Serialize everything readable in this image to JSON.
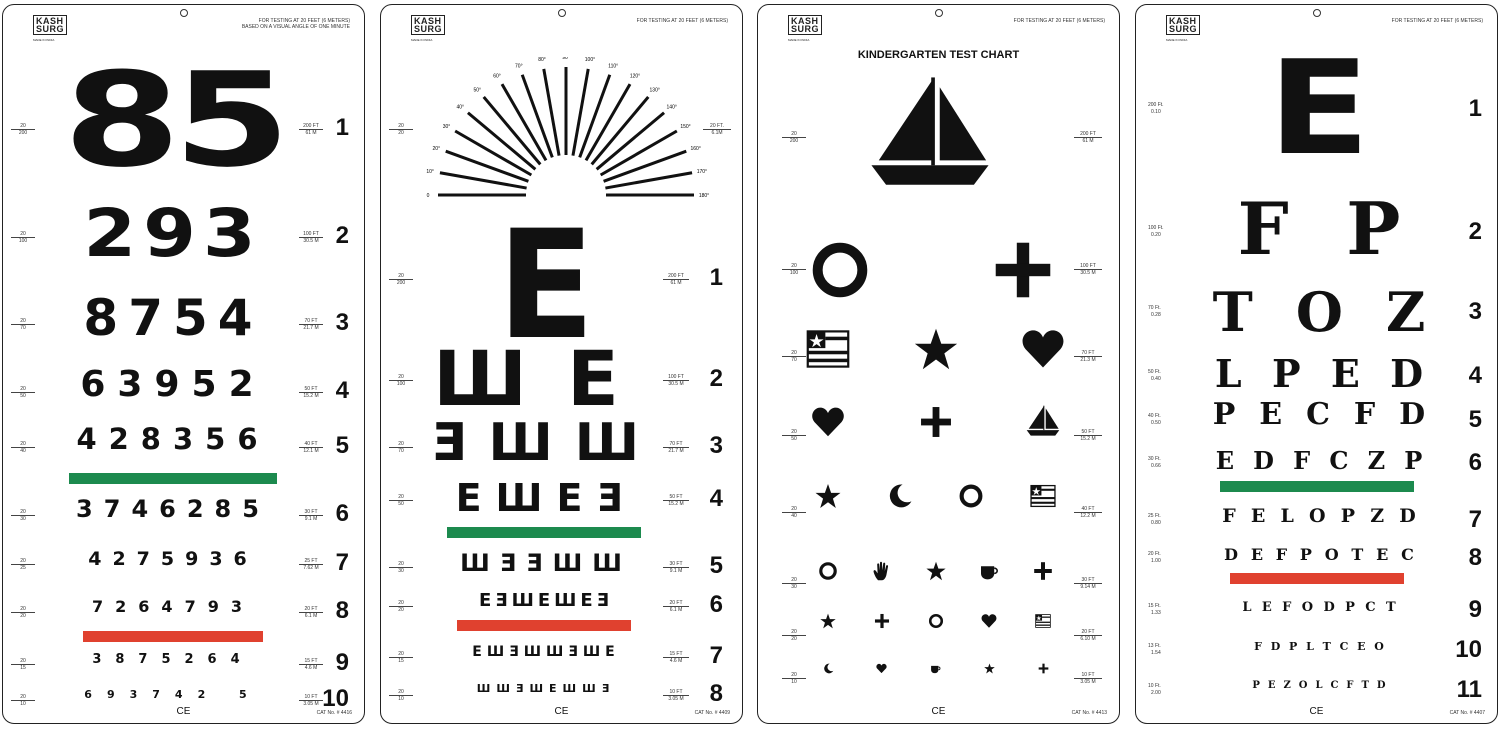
{
  "logo": {
    "line1": "KASH",
    "line2": "SURG",
    "sub": "MADE IN INDIA"
  },
  "header_line1": "FOR TESTING AT 20 FEET (6 METERS)",
  "header_line2": "BASED ON A VISUAL ANGLE OF ONE MINUTE",
  "ce_mark": "CE",
  "colors": {
    "green": "#1c8a4e",
    "red": "#e0412f"
  },
  "chart1": {
    "cat": "CAT No. # 4416",
    "rows": [
      {
        "snellen": [
          "20",
          "200"
        ],
        "text": "85",
        "feet": [
          "200 FT",
          "61 M"
        ],
        "num": "1"
      },
      {
        "snellen": [
          "20",
          "100"
        ],
        "text": "293",
        "feet": [
          "100 FT",
          "30.5 M"
        ],
        "num": "2"
      },
      {
        "snellen": [
          "20",
          "70"
        ],
        "text": "8754",
        "feet": [
          "70 FT",
          "21.7 M"
        ],
        "num": "3"
      },
      {
        "snellen": [
          "20",
          "50"
        ],
        "text": "63952",
        "feet": [
          "50 FT",
          "15.2 M"
        ],
        "num": "4"
      },
      {
        "snellen": [
          "20",
          "40"
        ],
        "text": "428356",
        "feet": [
          "40 FT",
          "12.1 M"
        ],
        "num": "5"
      },
      {
        "snellen": [
          "20",
          "30"
        ],
        "text": "3746285",
        "feet": [
          "30 FT",
          "9.1 M"
        ],
        "num": "6"
      },
      {
        "snellen": [
          "20",
          "25"
        ],
        "text": "4275936",
        "feet": [
          "25 FT",
          "7.62 M"
        ],
        "num": "7"
      },
      {
        "snellen": [
          "20",
          "20"
        ],
        "text": "7264793",
        "feet": [
          "20 FT",
          "6.1 M"
        ],
        "num": "8"
      },
      {
        "snellen": [
          "20",
          "15"
        ],
        "text": "3875264",
        "feet": [
          "15 FT",
          "4.6 M"
        ],
        "num": "9"
      },
      {
        "snellen": [
          "20",
          "10"
        ],
        "text": "693742 5",
        "feet": [
          "10 FT",
          "3.05 M"
        ],
        "num": "10"
      }
    ]
  },
  "chart2": {
    "cat": "CAT No. # 4409",
    "astig_labels": [
      "0",
      "10°",
      "20°",
      "30°",
      "40°",
      "50°",
      "60°",
      "70°",
      "80°",
      "90°",
      "100°",
      "110°",
      "120°",
      "130°",
      "140°",
      "150°",
      "160°",
      "170°",
      "180°"
    ],
    "astig_snellen": [
      "20",
      "20"
    ],
    "astig_feet": [
      "20 FT.",
      "6.1M"
    ],
    "rows": [
      {
        "snellen": [
          "20",
          "200"
        ],
        "text": "E",
        "feet": [
          "200 FT",
          "61 M"
        ],
        "num": "1"
      },
      {
        "snellen": [
          "20",
          "100"
        ],
        "text": "ШE",
        "feet": [
          "100 FT",
          "30.5 M"
        ],
        "num": "2"
      },
      {
        "snellen": [
          "20",
          "70"
        ],
        "text": "ƎШШ",
        "feet": [
          "70 FT",
          "21.7 M"
        ],
        "num": "3"
      },
      {
        "snellen": [
          "20",
          "50"
        ],
        "text": "EШEƎ",
        "feet": [
          "50 FT",
          "15.2 M"
        ],
        "num": "4"
      },
      {
        "snellen": [
          "20",
          "30"
        ],
        "text": "ШƎƎШШ",
        "feet": [
          "30 FT",
          "9.1 M"
        ],
        "num": "5"
      },
      {
        "snellen": [
          "20",
          "20"
        ],
        "text": "EƎШEШEƎ",
        "feet": [
          "20 FT",
          "6.1 M"
        ],
        "num": "6"
      },
      {
        "snellen": [
          "20",
          "15"
        ],
        "text": "EШƎШШƎШE",
        "feet": [
          "15 FT",
          "4.6 M"
        ],
        "num": "7"
      },
      {
        "snellen": [
          "20",
          "10"
        ],
        "text": "ШШƎШEШШƎ",
        "feet": [
          "10 FT",
          "3.05 M"
        ],
        "num": "8"
      }
    ]
  },
  "chart3": {
    "cat": "CAT No. # 4413",
    "title": "KINDERGARTEN TEST CHART",
    "rows": [
      {
        "snellen": [
          "20",
          "200"
        ],
        "feet": [
          "200 FT",
          "61 M"
        ],
        "icons": [
          "sailboat"
        ]
      },
      {
        "snellen": [
          "20",
          "100"
        ],
        "feet": [
          "100 FT",
          "30.5 M"
        ],
        "icons": [
          "circle",
          "plus"
        ]
      },
      {
        "snellen": [
          "20",
          "70"
        ],
        "feet": [
          "70 FT",
          "21.3 M"
        ],
        "icons": [
          "flag",
          "star",
          "heart"
        ]
      },
      {
        "snellen": [
          "20",
          "50"
        ],
        "feet": [
          "50 FT",
          "15.2 M"
        ],
        "icons": [
          "heart",
          "plus",
          "sailboat"
        ]
      },
      {
        "snellen": [
          "20",
          "40"
        ],
        "feet": [
          "40 FT",
          "12.2 M"
        ],
        "icons": [
          "star",
          "moon",
          "circle",
          "flag"
        ]
      },
      {
        "snellen": [
          "20",
          "30"
        ],
        "feet": [
          "30 FT",
          "9.14 M"
        ],
        "icons": [
          "circle",
          "hand",
          "star",
          "cup",
          "plus"
        ]
      },
      {
        "snellen": [
          "20",
          "20"
        ],
        "feet": [
          "20 FT",
          "6.10 M"
        ],
        "icons": [
          "star",
          "plus",
          "circle",
          "heart",
          "flag"
        ]
      },
      {
        "snellen": [
          "20",
          "10"
        ],
        "feet": [
          "10 FT",
          "3.05 M"
        ],
        "icons": [
          "moon",
          "heart",
          "cup",
          "star",
          "plus"
        ]
      }
    ]
  },
  "chart4": {
    "cat": "CAT No. # 4407",
    "rows": [
      {
        "feet": [
          "200 Ft.",
          "0.10"
        ],
        "text": "E",
        "num": "1"
      },
      {
        "feet": [
          "100 Ft.",
          "0.20"
        ],
        "text": "F P",
        "num": "2"
      },
      {
        "feet": [
          "70 Ft.",
          "0.28"
        ],
        "text": "T O Z",
        "num": "3"
      },
      {
        "feet": [
          "50 Ft.",
          "0.40"
        ],
        "text": "L P E D",
        "num": "4"
      },
      {
        "feet": [
          "40 Ft.",
          "0.50"
        ],
        "text": "P E C F D",
        "num": "5"
      },
      {
        "feet": [
          "30 Ft.",
          "0.66"
        ],
        "text": "E D F C Z P",
        "num": "6"
      },
      {
        "feet": [
          "25 Ft.",
          "0.80"
        ],
        "text": "F E L O P Z D",
        "num": "7"
      },
      {
        "feet": [
          "20 Ft.",
          "1.00"
        ],
        "text": "D E F P O T E C",
        "num": "8"
      },
      {
        "feet": [
          "15 Ft.",
          "1.33"
        ],
        "text": "L E F O D P C T",
        "num": "9"
      },
      {
        "feet": [
          "13 Ft.",
          "1.54"
        ],
        "text": "F D P L T C E O",
        "num": "10"
      },
      {
        "feet": [
          "10 Ft.",
          "2.00"
        ],
        "text": "P E Z O L C F T D",
        "num": "11"
      }
    ]
  }
}
